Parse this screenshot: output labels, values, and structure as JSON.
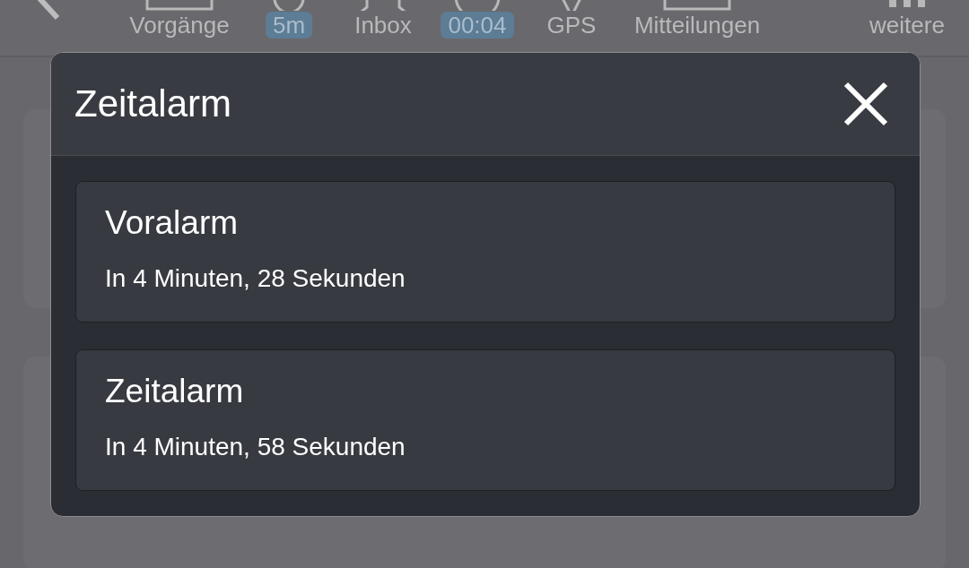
{
  "toolbar": {
    "items": [
      {
        "kind": "label",
        "text": "Vorgänge"
      },
      {
        "kind": "badge",
        "text": "5m"
      },
      {
        "kind": "label",
        "text": "Inbox"
      },
      {
        "kind": "badge",
        "text": "00:04"
      },
      {
        "kind": "label",
        "text": "GPS"
      },
      {
        "kind": "label",
        "text": "Mitteilungen"
      },
      {
        "kind": "label",
        "text": "weitere"
      }
    ]
  },
  "dialog": {
    "title": "Zeitalarm",
    "alarms": [
      {
        "name": "Voralarm",
        "time": "In 4 Minuten, 28 Sekunden"
      },
      {
        "name": "Zeitalarm",
        "time": "In 4 Minuten, 58 Sekunden"
      }
    ]
  }
}
